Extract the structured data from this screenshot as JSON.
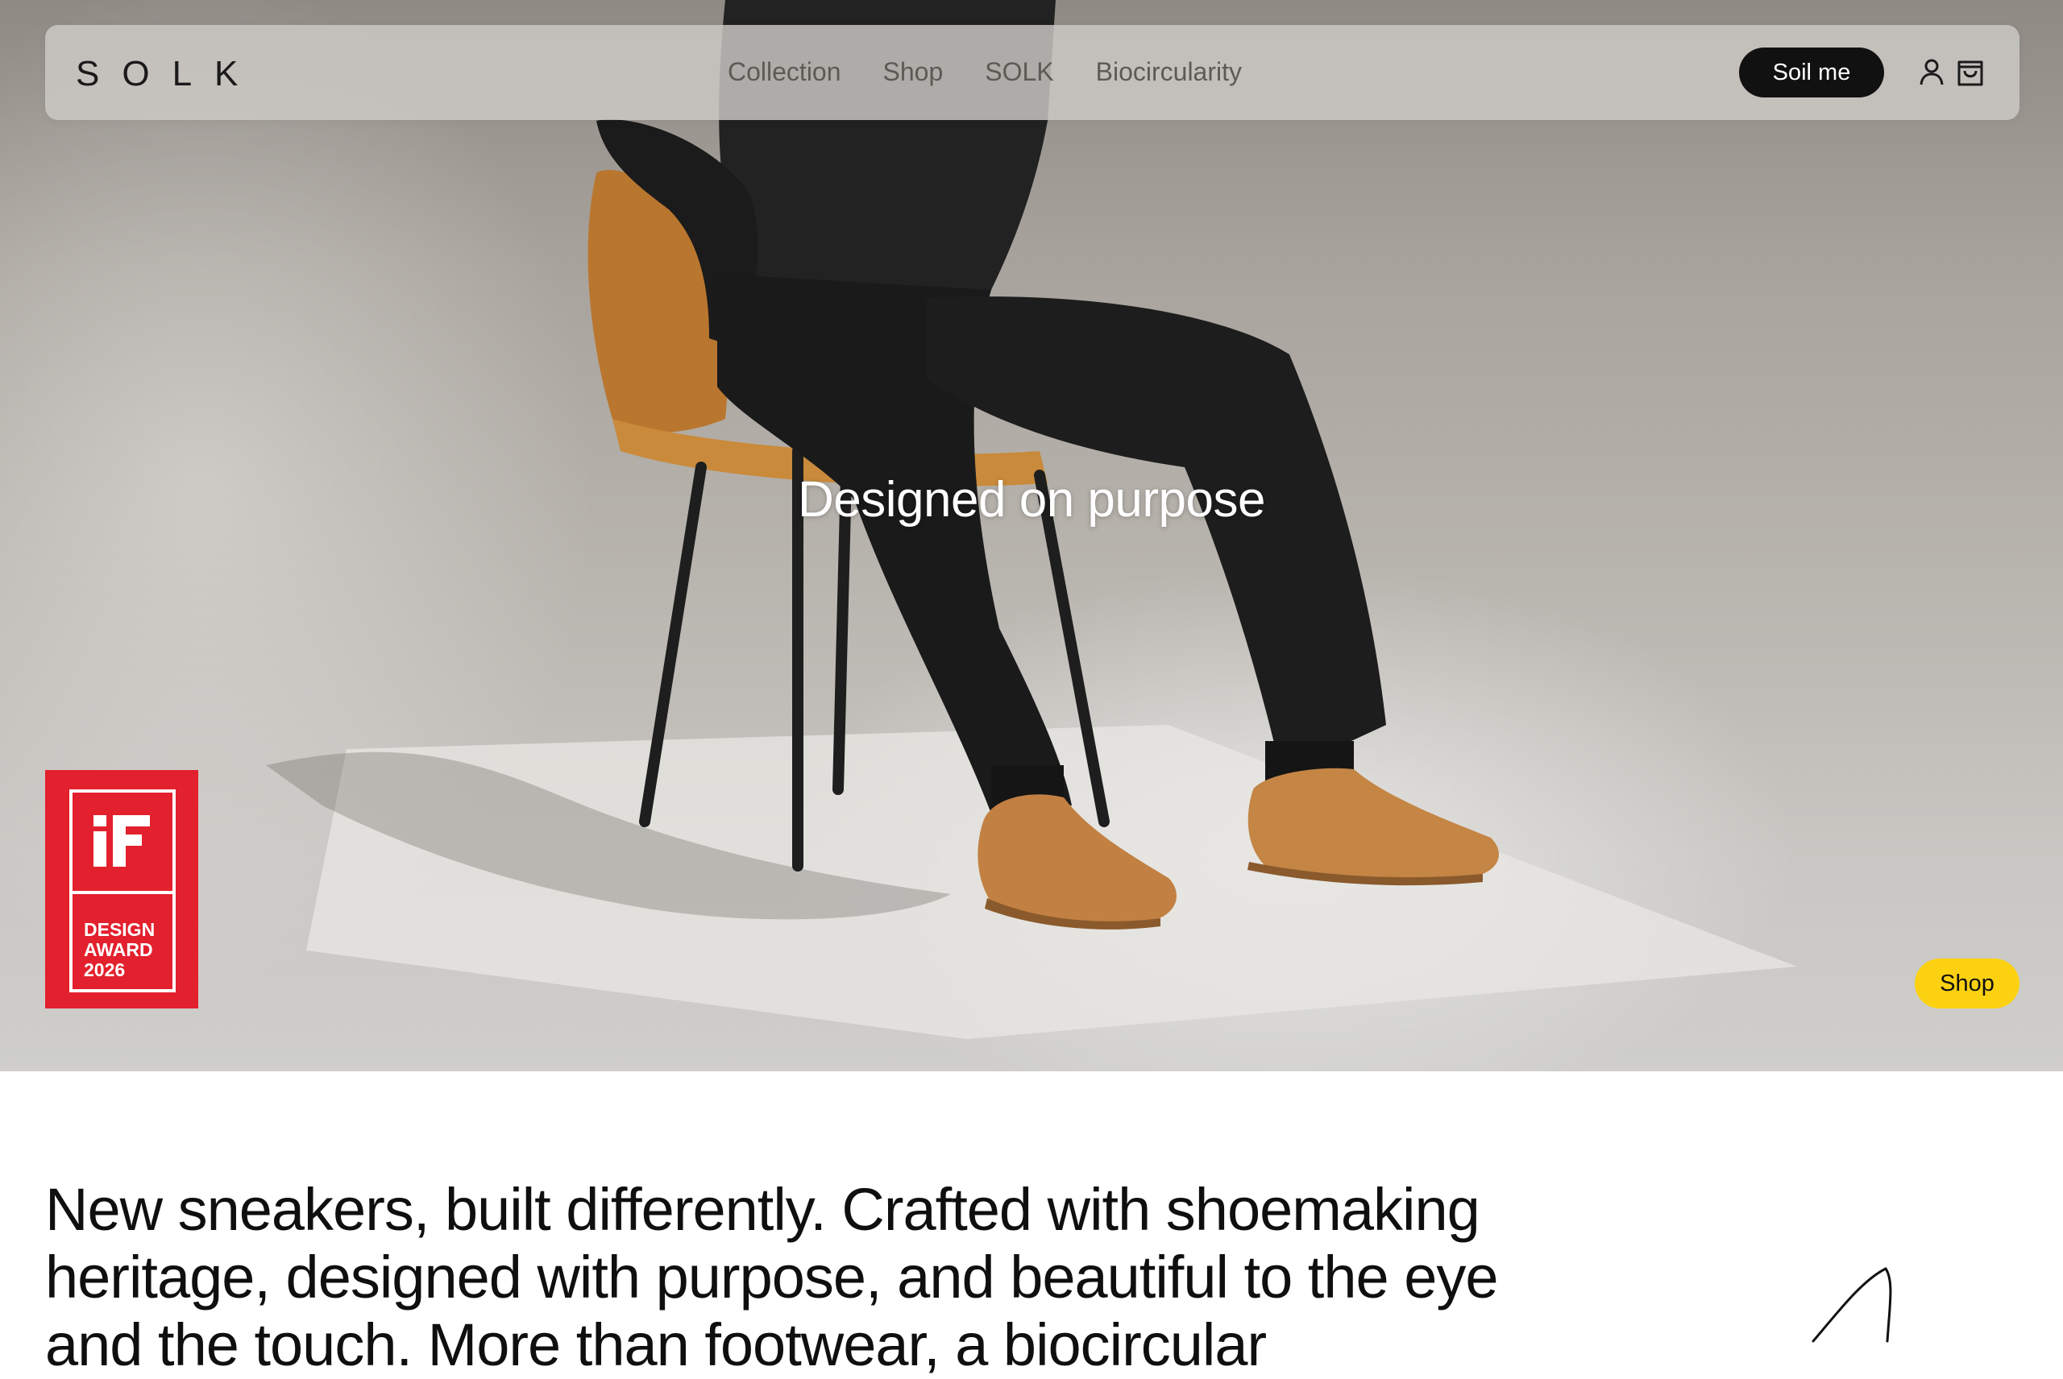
{
  "brand": {
    "logo_text": "SOLK"
  },
  "nav": {
    "menu": [
      "Collection",
      "Shop",
      "SOLK",
      "Biocircularity"
    ],
    "cta_label": "Soil me",
    "account_icon": "user-icon",
    "cart_icon": "shopping-bag-icon"
  },
  "hero": {
    "caption": "Designed on purpose",
    "shop_label": "Shop"
  },
  "award": {
    "logo_text": "iF",
    "line1": "DESIGN",
    "line2": "AWARD",
    "line3": "2026"
  },
  "intro": {
    "text": "New sneakers, built differently. Crafted with shoemaking heritage, designed with purpose, and beautiful to the eye and the touch. More than footwear, a biocircular"
  },
  "colors": {
    "award_red": "#e3202d",
    "shop_yellow": "#fbd112",
    "cta_black": "#111111"
  }
}
